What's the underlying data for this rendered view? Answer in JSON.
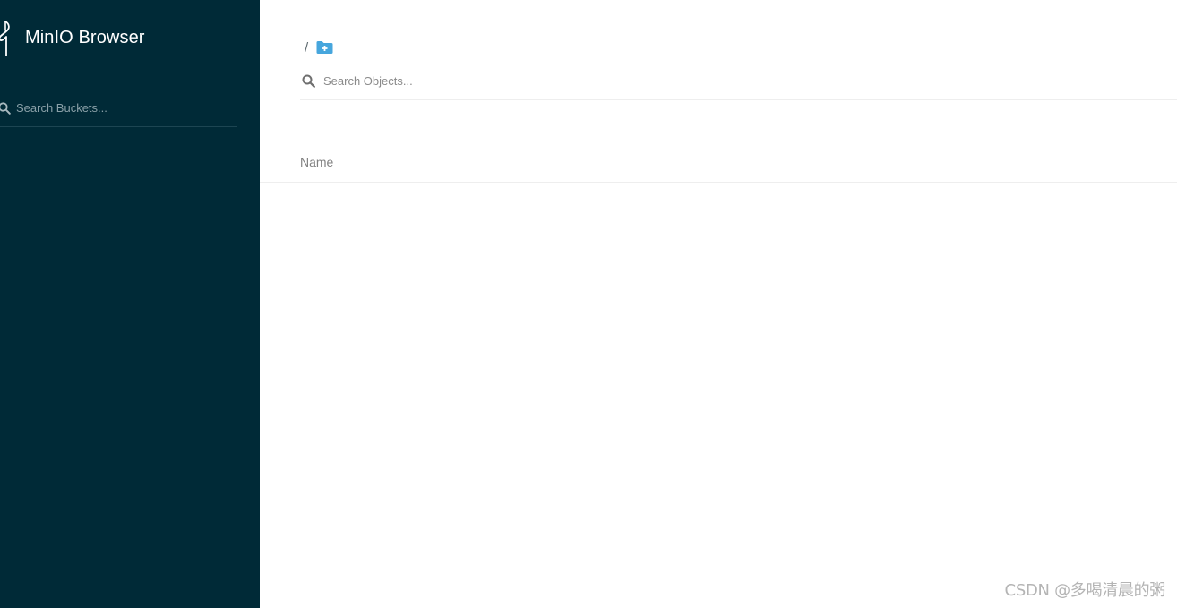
{
  "sidebar": {
    "app_title": "MinIO Browser",
    "search": {
      "placeholder": "Search Buckets..."
    }
  },
  "main": {
    "breadcrumb": {
      "separator": "/"
    },
    "add_folder_icon": "folder-plus-icon",
    "search": {
      "placeholder": "Search Objects..."
    },
    "table": {
      "columns": [
        "Name"
      ]
    }
  },
  "watermark": "CSDN @多喝清晨的粥",
  "colors": {
    "sidebar_bg": "#002a37",
    "accent": "#46a6dd",
    "text_muted": "#818181"
  }
}
